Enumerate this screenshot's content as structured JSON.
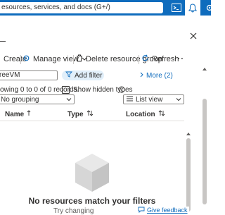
{
  "header": {
    "search_placeholder": "esources, services, and docs (G+/)",
    "cloud_shell_icon": "cloud-shell-icon",
    "notifications_icon": "bell-icon",
    "settings_icon": "gear-icon"
  },
  "toolbar": {
    "create_label": "Create",
    "manage_view_label": "Manage view",
    "delete_label": "Delete resource group",
    "refresh_label": "Refresh",
    "more_label": "···"
  },
  "filters": {
    "filter_value": "reeVM",
    "add_filter_label": "Add filter",
    "more_label": "More (2)"
  },
  "status": {
    "showing_text": "owing 0 to 0 of 0 records.",
    "show_hidden_label": "Show hidden types"
  },
  "selects": {
    "grouping_value": "No grouping",
    "view_value": "List view"
  },
  "table": {
    "columns": [
      {
        "label": "Name"
      },
      {
        "label": "Type"
      },
      {
        "label": "Location"
      }
    ]
  },
  "empty_state": {
    "title": "No resources match your filters",
    "subtitle": "Try changing",
    "feedback_label": "Give feedback"
  },
  "colors": {
    "brand": "#0f6cbd",
    "pill_bg": "#e1effa"
  }
}
